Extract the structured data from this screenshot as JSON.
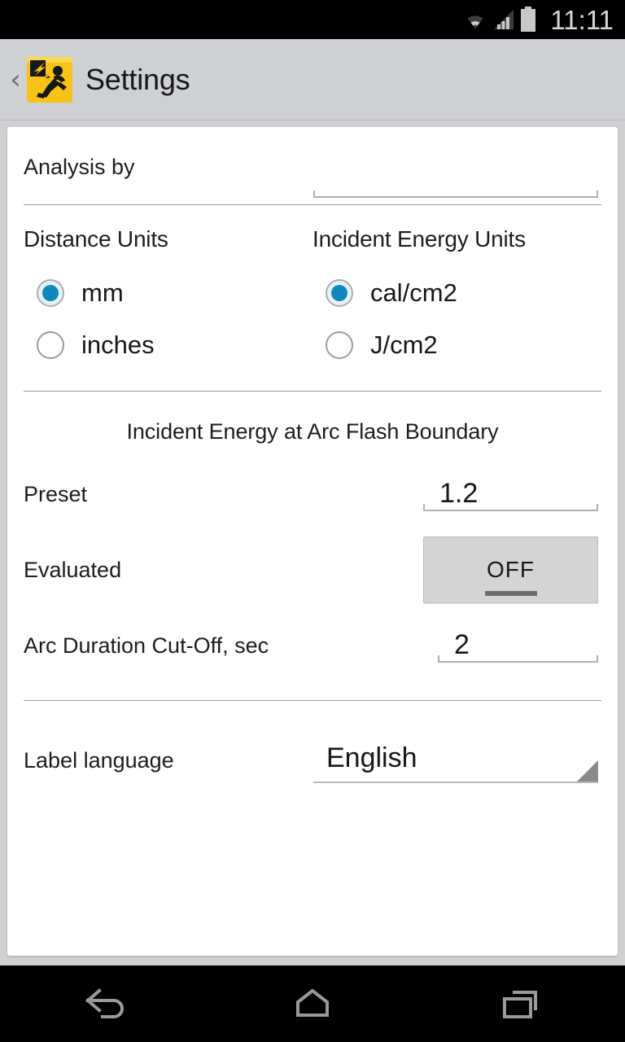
{
  "status_bar": {
    "time": "11:11",
    "icons": [
      "wifi-icon",
      "cell-signal-icon",
      "battery-icon"
    ]
  },
  "app_bar": {
    "back_label": "‹",
    "app_icon_name": "arc-flash-hazard-icon",
    "title": "Settings"
  },
  "settings": {
    "analysis": {
      "label": "Analysis by",
      "value": "",
      "placeholder": ""
    },
    "distance_units": {
      "title": "Distance Units",
      "options": [
        {
          "label": "mm",
          "selected": true
        },
        {
          "label": "inches",
          "selected": false
        }
      ]
    },
    "incident_energy_units": {
      "title": "Incident Energy Units",
      "options": [
        {
          "label": "cal/cm2",
          "selected": true
        },
        {
          "label": "J/cm2",
          "selected": false
        }
      ]
    },
    "incident_energy_section": {
      "title": "Incident Energy at Arc Flash Boundary",
      "preset": {
        "label": "Preset",
        "value": "1.2"
      },
      "evaluated": {
        "label": "Evaluated",
        "toggle_state": "OFF"
      },
      "arc_duration": {
        "label": "Arc Duration Cut-Off, sec",
        "value": "2"
      }
    },
    "label_language": {
      "label": "Label language",
      "value": "English"
    }
  },
  "nav_bar": {
    "back": "back-icon",
    "home": "home-icon",
    "recents": "recents-icon"
  },
  "colors": {
    "accent_blue": "#0f88bf",
    "app_bar": "#ced0d3",
    "page_bg": "#d0d0d0",
    "card": "#ffffff",
    "icon_yellow": "#f6c316"
  }
}
